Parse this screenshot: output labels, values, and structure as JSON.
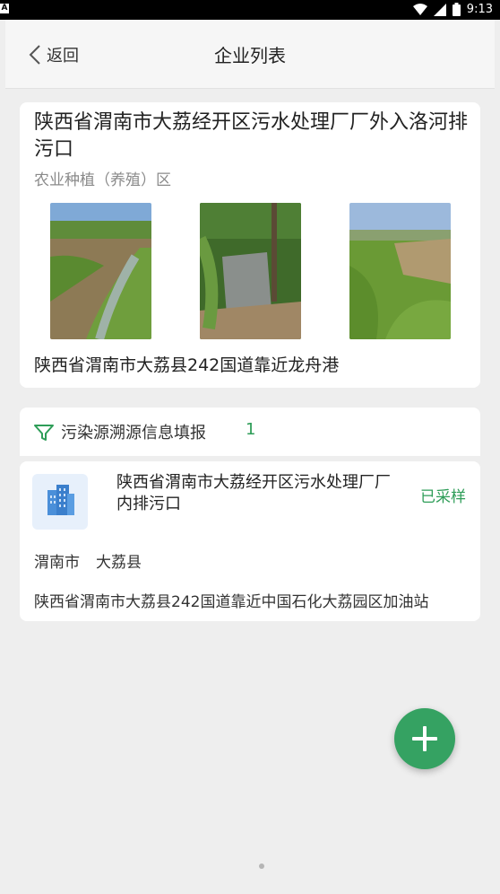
{
  "status_bar": {
    "left_badge": "A",
    "time": "9:13",
    "icons": [
      "wifi-icon",
      "signal-icon",
      "battery-icon"
    ]
  },
  "nav": {
    "back_label": "返回",
    "title": "企业列表"
  },
  "outfall_card": {
    "title": "陕西省渭南市大荔经开区污水处理厂厂外入洛河排污口",
    "category": "农业种植（养殖）区",
    "address": "陕西省渭南市大荔县242国道靠近龙舟港"
  },
  "trace_section": {
    "label": "污染源溯源信息填报",
    "count": "1"
  },
  "trace_item": {
    "title": "陕西省渭南市大荔经开区污水处理厂厂内排污口",
    "status": "已采样",
    "city": "渭南市",
    "county": "大荔县",
    "address": "陕西省渭南市大荔县242国道靠近中国石化大荔园区加油站"
  },
  "colors": {
    "accent": "#35a262",
    "status_green": "#2e9d58"
  }
}
